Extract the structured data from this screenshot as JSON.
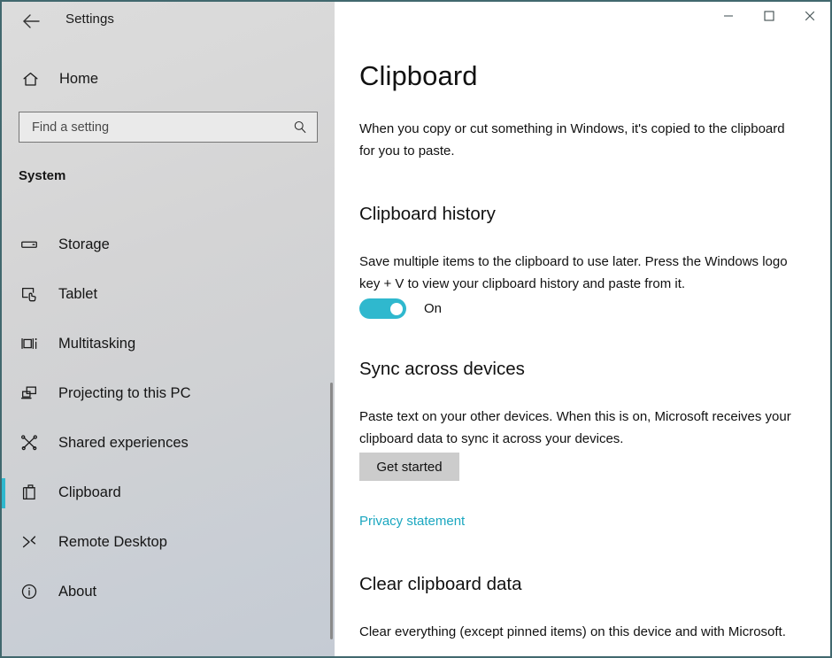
{
  "window": {
    "app_title": "Settings",
    "back_icon": "back-arrow-icon",
    "accent_color": "#2fb8ce",
    "border_color": "#41686e",
    "controls": {
      "minimize": "minimize-icon",
      "maximize": "maximize-icon",
      "close": "close-icon"
    }
  },
  "sidebar": {
    "home_label": "Home",
    "home_icon": "home-icon",
    "search": {
      "placeholder": "Find a setting",
      "value": "",
      "icon": "search-icon"
    },
    "section_label": "System",
    "items": [
      {
        "label": "Storage",
        "icon": "storage-icon",
        "selected": false
      },
      {
        "label": "Tablet",
        "icon": "tablet-icon",
        "selected": false
      },
      {
        "label": "Multitasking",
        "icon": "multitasking-icon",
        "selected": false
      },
      {
        "label": "Projecting to this PC",
        "icon": "projecting-icon",
        "selected": false
      },
      {
        "label": "Shared experiences",
        "icon": "shared-experiences-icon",
        "selected": false
      },
      {
        "label": "Clipboard",
        "icon": "clipboard-icon",
        "selected": true
      },
      {
        "label": "Remote Desktop",
        "icon": "remote-desktop-icon",
        "selected": false
      },
      {
        "label": "About",
        "icon": "info-icon",
        "selected": false
      }
    ]
  },
  "main": {
    "page_title": "Clipboard",
    "intro": "When you copy or cut something in Windows, it's copied to the clipboard for you to paste.",
    "sections": {
      "history": {
        "title": "Clipboard history",
        "description": "Save multiple items to the clipboard to use later. Press the Windows logo key + V to view your clipboard history and paste from it.",
        "toggle_state": "On",
        "toggle_on": true
      },
      "sync": {
        "title": "Sync across devices",
        "description": "Paste text on your other devices. When this is on, Microsoft receives your clipboard data to sync it across your devices.",
        "button_label": "Get started",
        "link_label": "Privacy statement",
        "link_color": "#1ba7c0"
      },
      "clear": {
        "title": "Clear clipboard data",
        "description": "Clear everything (except pinned items) on this device and with Microsoft."
      }
    }
  }
}
